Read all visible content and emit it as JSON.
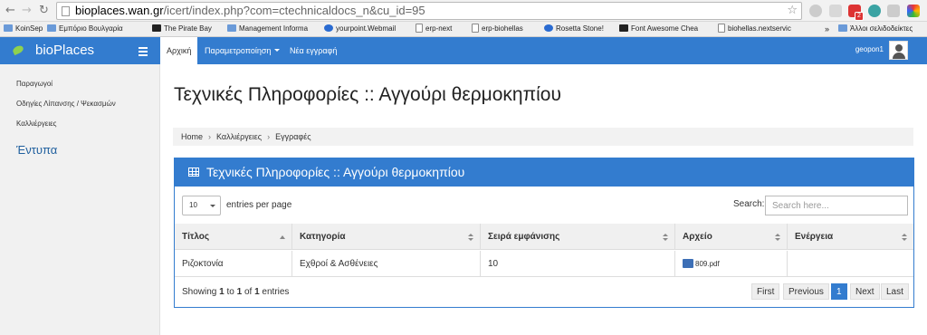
{
  "browser": {
    "url_host": "bioplaces.wan.gr",
    "url_path": "/icert/index.php?com=ctechnicaldocs_n&cu_id=95",
    "bookmarks": [
      {
        "label": "KoinSep",
        "icon": "folder-icon"
      },
      {
        "label": "Εμπόριο Βουλγαρία",
        "icon": "folder-icon"
      },
      {
        "label": "The Pirate Bay",
        "icon": "ship-icon"
      },
      {
        "label": "Management Informa",
        "icon": "folder-icon"
      },
      {
        "label": "yourpoint.Webmail",
        "icon": "mail-icon"
      },
      {
        "label": "erp-next",
        "icon": "page-icon"
      },
      {
        "label": "erp-biohellas",
        "icon": "page-icon"
      },
      {
        "label": "Rosetta Stone!",
        "icon": "drop-icon"
      },
      {
        "label": "Font Awesome Chea",
        "icon": "flag-icon"
      },
      {
        "label": "biohellas.nextservic",
        "icon": "page-icon"
      },
      {
        "label": "»",
        "icon": ""
      },
      {
        "label": "Άλλοι σελιδοδείκτες",
        "icon": "folder-icon"
      }
    ],
    "gmail_badge": "2"
  },
  "nav": {
    "brand": "bioPlaces",
    "tabs": [
      {
        "label": "Αρχική"
      },
      {
        "label": "Παραμετροποίηση"
      },
      {
        "label": "Νέα εγγραφή"
      }
    ],
    "user": "geopon1"
  },
  "sidebar": {
    "items": [
      {
        "label": "Παραγωγοί"
      },
      {
        "label": "Οδηγίες Λίπανσης / Ψεκασμών"
      },
      {
        "label": "Καλλιέργειες"
      }
    ],
    "section_title": "Έντυπα"
  },
  "page": {
    "title": "Τεχνικές Πληροφορίες :: Αγγούρι θερμοκηπίου",
    "breadcrumb": [
      "Home",
      "Καλλιέργειες",
      "Εγγραφές"
    ]
  },
  "panel": {
    "title": "Τεχνικές Πληροφορίες :: Αγγούρι θερμοκηπίου",
    "per_page_value": "10",
    "per_page_label": "entries per page",
    "search_label": "Search:",
    "search_placeholder": "Search here...",
    "columns": [
      "Τίτλος",
      "Κατηγορία",
      "Σειρά εμφάνισης",
      "Αρχείο",
      "Ενέργεια"
    ],
    "rows": [
      {
        "title": "Ριζοκτονία",
        "category": "Εχθροί & Ασθένειες",
        "order": "10",
        "file": "809.pdf",
        "action": ""
      }
    ],
    "info": {
      "prefix": "Showing ",
      "from": "1",
      "to_word": " to ",
      "to": "1",
      "of_word": " of ",
      "total": "1",
      "suffix": " entries"
    },
    "pager": [
      "First",
      "Previous",
      "1",
      "Next",
      "Last"
    ]
  }
}
